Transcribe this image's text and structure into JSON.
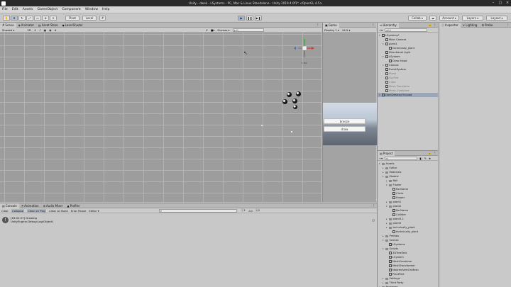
{
  "window": {
    "title": "Unity - dwek - LSystems - PC, Mac & Linux Standalone - Unity 2019.4.0f1* <OpenGL 4.5>"
  },
  "menu": [
    "File",
    "Edit",
    "Assets",
    "GameObject",
    "Component",
    "Window",
    "Help"
  ],
  "toolbar": {
    "pivot": "Pivot",
    "local": "Local",
    "collab": "Collab",
    "account": "Account",
    "layers": "Layers",
    "layout": "Layout"
  },
  "scene_tabs": [
    "Scene",
    "Animator",
    "Asset Store",
    "LaserShader"
  ],
  "scene_bar": {
    "shading": "Shaded",
    "mode": "2D",
    "gizmos": "Gizmos",
    "search": "All"
  },
  "scene_gizmo": {
    "label": "< Iso",
    "x": "x",
    "y": "y",
    "z": "z"
  },
  "game": {
    "tab": "Game",
    "display": "Display 1",
    "aspect": "16:9",
    "btn1": "breeze",
    "btn2": "draw"
  },
  "hierarchy": {
    "tab": "Hierarchy",
    "search": "All",
    "items": [
      {
        "t": "LSystems*",
        "d": 0,
        "k": "scene"
      },
      {
        "t": "Main Camera",
        "d": 1
      },
      {
        "t": "plant1",
        "d": 1,
        "k": "fold"
      },
      {
        "t": "technically_plant",
        "d": 2
      },
      {
        "t": "Directional Light",
        "d": 1
      },
      {
        "t": "LSystem",
        "d": 1,
        "k": "fold"
      },
      {
        "t": "Draw Head",
        "d": 2
      },
      {
        "t": "Canvas",
        "d": 1,
        "k": "fold"
      },
      {
        "t": "EventSystem",
        "d": 1
      },
      {
        "t": "Plane",
        "d": 1,
        "g": true
      },
      {
        "t": "SkyFlat",
        "d": 1,
        "g": true
      },
      {
        "t": "Cube",
        "d": 1,
        "g": true
      },
      {
        "t": "Mesh Transform",
        "d": 1,
        "g": true
      },
      {
        "t": "Mesh Combiner",
        "d": 1,
        "g": true
      },
      {
        "t": "DontDestroyOnLoad",
        "d": 0,
        "k": "scene",
        "sel": true
      }
    ]
  },
  "inspector": {
    "tabs": [
      "Inspector",
      "Lighting",
      "Probe"
    ]
  },
  "project": {
    "tab": "Project",
    "search": "",
    "items": [
      {
        "t": "Assets",
        "d": 0,
        "k": "fold"
      },
      {
        "t": "Editor",
        "d": 1,
        "k": "folder"
      },
      {
        "t": "Materials",
        "d": 1,
        "k": "folder"
      },
      {
        "t": "Models",
        "d": 1,
        "k": "fold"
      },
      {
        "t": "Ball",
        "d": 2,
        "k": "folder"
      },
      {
        "t": "Flower",
        "d": 2,
        "k": "fold"
      },
      {
        "t": "No Name",
        "d": 3
      },
      {
        "t": "Circle",
        "d": 3
      },
      {
        "t": "Flower",
        "d": 3
      },
      {
        "t": "plant1",
        "d": 2,
        "k": "folder"
      },
      {
        "t": "plant2",
        "d": 2,
        "k": "fold"
      },
      {
        "t": "No Name",
        "d": 3
      },
      {
        "t": "Collider",
        "d": 3
      },
      {
        "t": "plant3-1",
        "d": 2,
        "k": "folder"
      },
      {
        "t": "plant3",
        "d": 2,
        "k": "folder"
      },
      {
        "t": "technically_plant",
        "d": 2,
        "k": "folder"
      },
      {
        "t": "technically_plant",
        "d": 3
      },
      {
        "t": "Prefabs",
        "d": 1,
        "k": "folder"
      },
      {
        "t": "Scenes",
        "d": 1,
        "k": "fold"
      },
      {
        "t": "LSystems",
        "d": 2
      },
      {
        "t": "Scripts",
        "d": 1,
        "k": "fold"
      },
      {
        "t": "3DTreeTest",
        "d": 2
      },
      {
        "t": "LSystem",
        "d": 2
      },
      {
        "t": "MeshCombiner",
        "d": 2
      },
      {
        "t": "MeshTransformer",
        "d": 2
      },
      {
        "t": "NearestVertOnMesh",
        "d": 2
      },
      {
        "t": "PlantPart",
        "d": 2
      },
      {
        "t": "Settings",
        "d": 1,
        "k": "folder"
      },
      {
        "t": "Third Party",
        "d": 1,
        "k": "folder"
      },
      {
        "t": "Packages",
        "d": 0,
        "k": "folder"
      }
    ]
  },
  "console": {
    "tabs": [
      "Console",
      "Animation",
      "Audio Mixer",
      "Profiler"
    ],
    "buttons": [
      "Clear",
      "Collapse",
      "Clear on Play",
      "Clear on Build",
      "Error Pause",
      "Editor"
    ],
    "counts": {
      "log": "1",
      "warn": "0",
      "err": "0"
    },
    "entry": {
      "line1": "[18:02:07] Growing",
      "line2": "UnityEngine.Debug:Log(Object)",
      "count": "1"
    }
  },
  "colors": {
    "accent": "#3d6fb4",
    "selection": "#9aa7b8"
  }
}
